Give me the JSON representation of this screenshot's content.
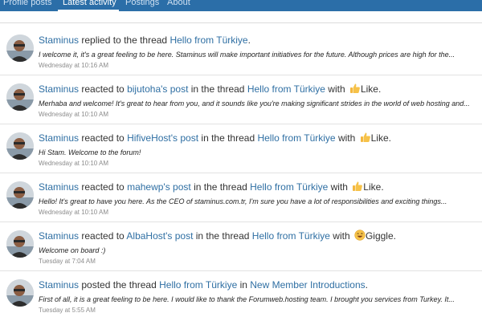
{
  "tabs": [
    {
      "label": "Profile posts",
      "active": false
    },
    {
      "label": "Latest activity",
      "active": true
    },
    {
      "label": "Postings",
      "active": false
    },
    {
      "label": "About",
      "active": false
    }
  ],
  "colors": {
    "tab_bar": "#2b6ea8",
    "link": "#2f6fa3",
    "timestamp": "#8c8c8c"
  },
  "feed": [
    {
      "user": "Staminus",
      "action": " replied to the thread ",
      "thread": "Hello from Türkiye",
      "tail": ".",
      "excerpt": "I welcome it, it's a great feeling to be here. Staminus will make important initiatives for the future. Although prices are high for the...",
      "time": "Wednesday at 10:16 AM"
    },
    {
      "user": "Staminus",
      "action": " reacted to ",
      "target": "bijutoha's post",
      "mid": " in the thread ",
      "thread": "Hello from Türkiye",
      "with": " with ",
      "reaction": "Like",
      "reaction_icon": "thumbs-up-icon",
      "tail": ".",
      "excerpt": "Merhaba and welcome! It's great to hear from you, and it sounds like you're making significant strides in the world of web hosting and...",
      "time": "Wednesday at 10:10 AM"
    },
    {
      "user": "Staminus",
      "action": " reacted to ",
      "target": "HifiveHost's post",
      "mid": " in the thread ",
      "thread": "Hello from Türkiye",
      "with": " with ",
      "reaction": "Like",
      "reaction_icon": "thumbs-up-icon",
      "tail": ".",
      "excerpt": "Hi Stam. Welcome to the forum!",
      "time": "Wednesday at 10:10 AM"
    },
    {
      "user": "Staminus",
      "action": " reacted to ",
      "target": "mahewp's post",
      "mid": " in the thread ",
      "thread": "Hello from Türkiye",
      "with": " with ",
      "reaction": "Like",
      "reaction_icon": "thumbs-up-icon",
      "tail": ".",
      "excerpt": "Hello! It's great to have you here. As the CEO of staminus.com.tr, I'm sure you have a lot of responsibilities and exciting things...",
      "time": "Wednesday at 10:10 AM"
    },
    {
      "user": "Staminus",
      "action": " reacted to ",
      "target": "AlbaHost's post",
      "mid": " in the thread ",
      "thread": "Hello from Türkiye",
      "with": " with ",
      "reaction": "Giggle",
      "reaction_icon": "giggle-face-icon",
      "tail": ".",
      "excerpt": "Welcome on board :)",
      "time": "Tuesday at 7:04 AM"
    },
    {
      "user": "Staminus",
      "action": " posted the thread ",
      "thread": "Hello from Türkiye",
      "mid": " in ",
      "forum": "New Member Introductions",
      "tail": ".",
      "excerpt": "First of all, it is a great feeling to be here. I would like to thank the Forumweb.hosting team. I brought you services from Turkey. It...",
      "time": "Tuesday at 5:55 AM"
    }
  ]
}
